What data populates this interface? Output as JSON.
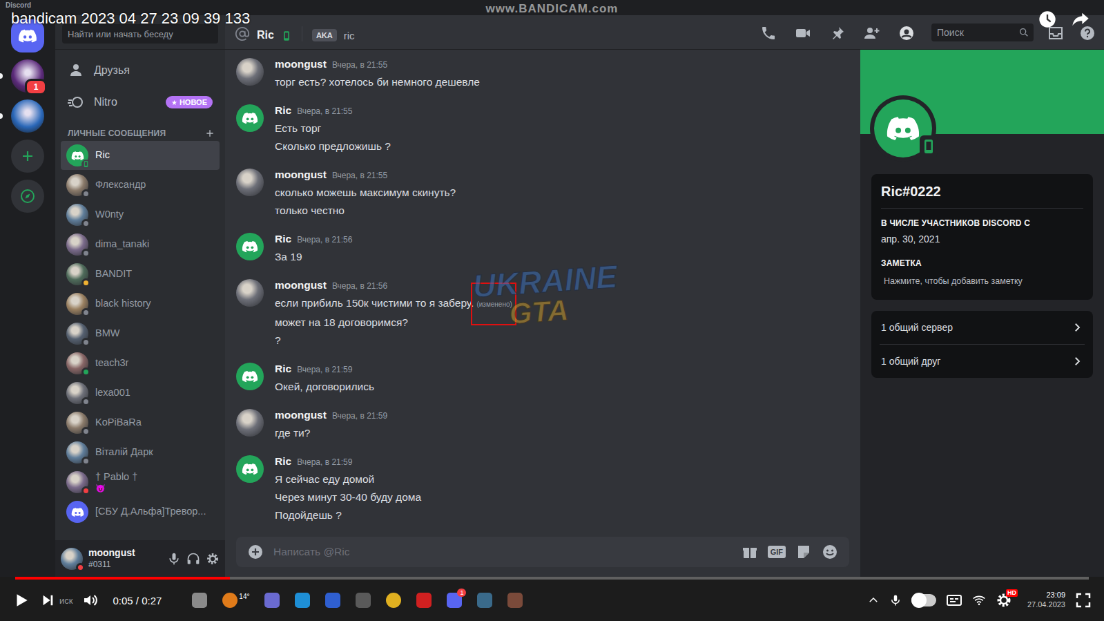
{
  "video": {
    "title": "bandicam 2023 04 27 23 09 39 133",
    "watermark": "www.BANDICAM.com",
    "logo": [
      "UKRAINE",
      "GTA"
    ],
    "time": "0:05 / 0:27",
    "progress": 0.2,
    "quality": "HD"
  },
  "window": {
    "title": "Discord"
  },
  "servers": [
    {
      "kind": "home",
      "unread": false
    },
    {
      "kind": "avatar",
      "color": "#5b2a7a",
      "badge": "1",
      "unread": true
    },
    {
      "kind": "avatar",
      "color": "#2a67b8",
      "unread": true
    }
  ],
  "sidebar": {
    "search": {
      "placeholder": "Найти или начать беседу"
    },
    "nav": [
      {
        "label": "Друзья"
      },
      {
        "label": "Nitro",
        "badge": "НОВОЕ"
      }
    ],
    "section": "ЛИЧНЫЕ СООБЩЕНИЯ",
    "dms": [
      {
        "name": "Ric",
        "selected": true,
        "kind": "discord",
        "avatar_color": "#23a55a",
        "color": "#23a55a",
        "mobile": true
      },
      {
        "name": "Флександр",
        "selected": false,
        "kind": "photo",
        "color": "#80848e",
        "mobile": false
      },
      {
        "name": "W0nty",
        "selected": false,
        "kind": "photo",
        "color": "#80848e",
        "mobile": false
      },
      {
        "name": "dima_tanaki",
        "selected": false,
        "kind": "photo",
        "color": "#80848e",
        "mobile": false
      },
      {
        "name": "BANDIT",
        "selected": false,
        "kind": "photo",
        "color": "#f0b232",
        "mobile": false
      },
      {
        "name": "black history",
        "selected": false,
        "kind": "photo",
        "color": "#80848e",
        "mobile": false
      },
      {
        "name": "BMW",
        "selected": false,
        "kind": "photo",
        "color": "#80848e",
        "mobile": false
      },
      {
        "name": "teach3r",
        "selected": false,
        "kind": "photo",
        "color": "#23a55a",
        "mobile": false
      },
      {
        "name": "lexa001",
        "selected": false,
        "kind": "photo",
        "color": "#80848e",
        "mobile": false
      },
      {
        "name": "KoPiBaRa",
        "selected": false,
        "kind": "photo",
        "color": "#80848e",
        "mobile": false
      },
      {
        "name": "Віталій Дарк",
        "selected": false,
        "kind": "photo",
        "color": "#80848e",
        "mobile": false
      },
      {
        "name": "† Pablo †",
        "selected": false,
        "kind": "photo",
        "color": "#f23f43",
        "mobile": false,
        "activity": "😈"
      },
      {
        "name": "[СБУ Д.Альфа]Тревор...",
        "selected": false,
        "kind": "discord",
        "avatar_color": "#5865f2"
      }
    ]
  },
  "user": {
    "name": "moongust",
    "tag": "#0311",
    "color": "#f23f43"
  },
  "chat": {
    "recipient": "Ric",
    "aka_label": "AKA",
    "aka": "ric",
    "search": {
      "placeholder": "Поиск"
    },
    "input": {
      "placeholder": "Написать @Ric",
      "gif_label": "GIF"
    },
    "messages": [
      {
        "author": "moongust",
        "kind": "photo",
        "time": "Вчера, в 21:55",
        "lines": [
          {
            "text": "торг есть? хотелось би немного дешевле"
          }
        ]
      },
      {
        "author": "Ric",
        "kind": "discord",
        "avatar_color": "#23a55a",
        "time": "Вчера, в 21:55",
        "lines": [
          {
            "text": "Есть торг"
          },
          {
            "text": "Сколько предложишь ?"
          }
        ]
      },
      {
        "author": "moongust",
        "kind": "photo",
        "time": "Вчера, в 21:55",
        "lines": [
          {
            "text": "сколько можешь максимум скинуть?"
          },
          {
            "text": "только честно"
          }
        ]
      },
      {
        "author": "Ric",
        "kind": "discord",
        "avatar_color": "#23a55a",
        "time": "Вчера, в 21:56",
        "lines": [
          {
            "text": "За 19"
          }
        ]
      },
      {
        "author": "moongust",
        "kind": "photo",
        "time": "Вчера, в 21:56",
        "lines": [
          {
            "text": "если прибиль 150к чистими то я заберу.",
            "edited": "(изменено)",
            "annotated": true
          },
          {
            "text": "может на 18 договоримся?"
          },
          {
            "text": "?"
          }
        ]
      },
      {
        "author": "Ric",
        "kind": "discord",
        "avatar_color": "#23a55a",
        "time": "Вчера, в 21:59",
        "lines": [
          {
            "text": "Окей, договорились"
          }
        ]
      },
      {
        "author": "moongust",
        "kind": "photo",
        "time": "Вчера, в 21:59",
        "lines": [
          {
            "text": "где ти?"
          }
        ]
      },
      {
        "author": "Ric",
        "kind": "discord",
        "avatar_color": "#23a55a",
        "time": "Вчера, в 21:59",
        "lines": [
          {
            "text": "Я сейчас еду домой"
          },
          {
            "text": "Через минут 30-40 буду дома"
          },
          {
            "text": "Подойдешь ?"
          }
        ]
      }
    ]
  },
  "profile": {
    "name": "Ric#0222",
    "avatar_color": "#23a55a",
    "color": "#23a55a",
    "mobile": true,
    "member_since_label": "В ЧИСЛЕ УЧАСТНИКОВ DISCORD С",
    "member_since": "апр. 30, 2021",
    "note_label": "ЗАМЕТКА",
    "note_placeholder": "Нажмите, чтобы добавить заметку",
    "mutuals": [
      {
        "label": "1 общий сервер"
      },
      {
        "label": "1 общий друг"
      }
    ]
  },
  "taskbar": {
    "search": "иск",
    "weather": "14°",
    "discord_badge": "1",
    "time": "23:09",
    "date": "27.04.2023"
  }
}
